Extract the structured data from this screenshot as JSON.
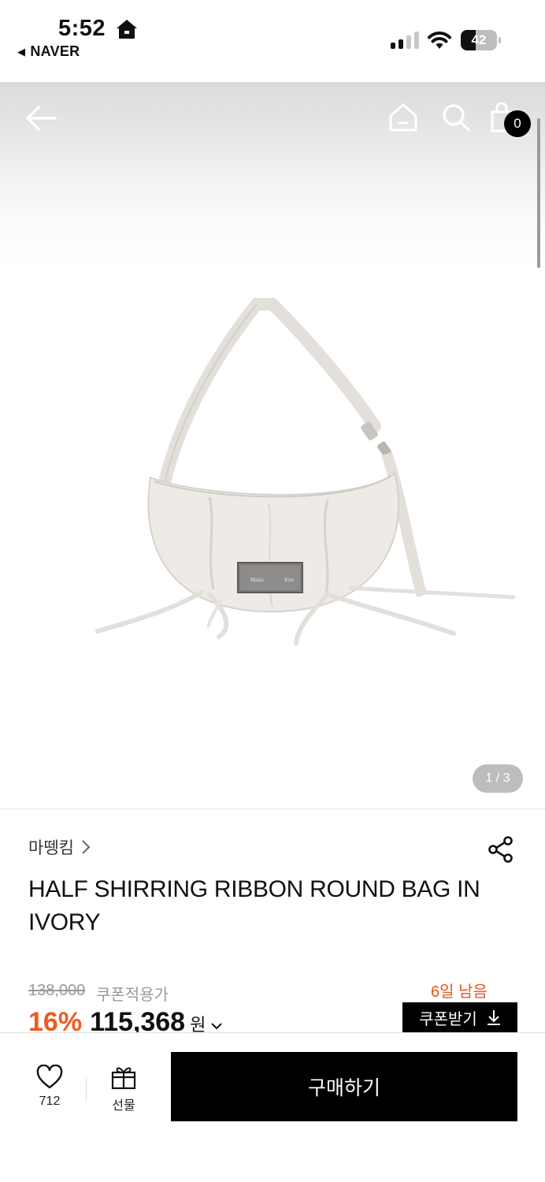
{
  "status_bar": {
    "time": "5:52",
    "back_app": "NAVER",
    "battery_level": "42",
    "battery_fraction": 0.42
  },
  "header": {
    "cart_count": "0",
    "icons": [
      "back-arrow-icon",
      "home-icon",
      "search-icon",
      "cart-icon"
    ]
  },
  "gallery": {
    "page_indicator": "1 / 3"
  },
  "product": {
    "brand": "마뗑킴",
    "title": "HALF SHIRRING RIBBON ROUND BAG IN IVORY",
    "original_price": "138,000",
    "coupon_note": "쿠폰적용가",
    "days_left": "6일 남음",
    "discount": "16%",
    "sale_price": "115,368",
    "currency": "원",
    "coupon_button": "쿠폰받기",
    "plate_text_left": "Matin",
    "plate_text_right": "Kim"
  },
  "bottom_bar": {
    "like_count": "712",
    "gift_label": "선물",
    "buy_label": "구매하기"
  },
  "colors": {
    "accent": "#ee5a1f",
    "primary_button": "#000000",
    "muted_text": "#999999"
  }
}
